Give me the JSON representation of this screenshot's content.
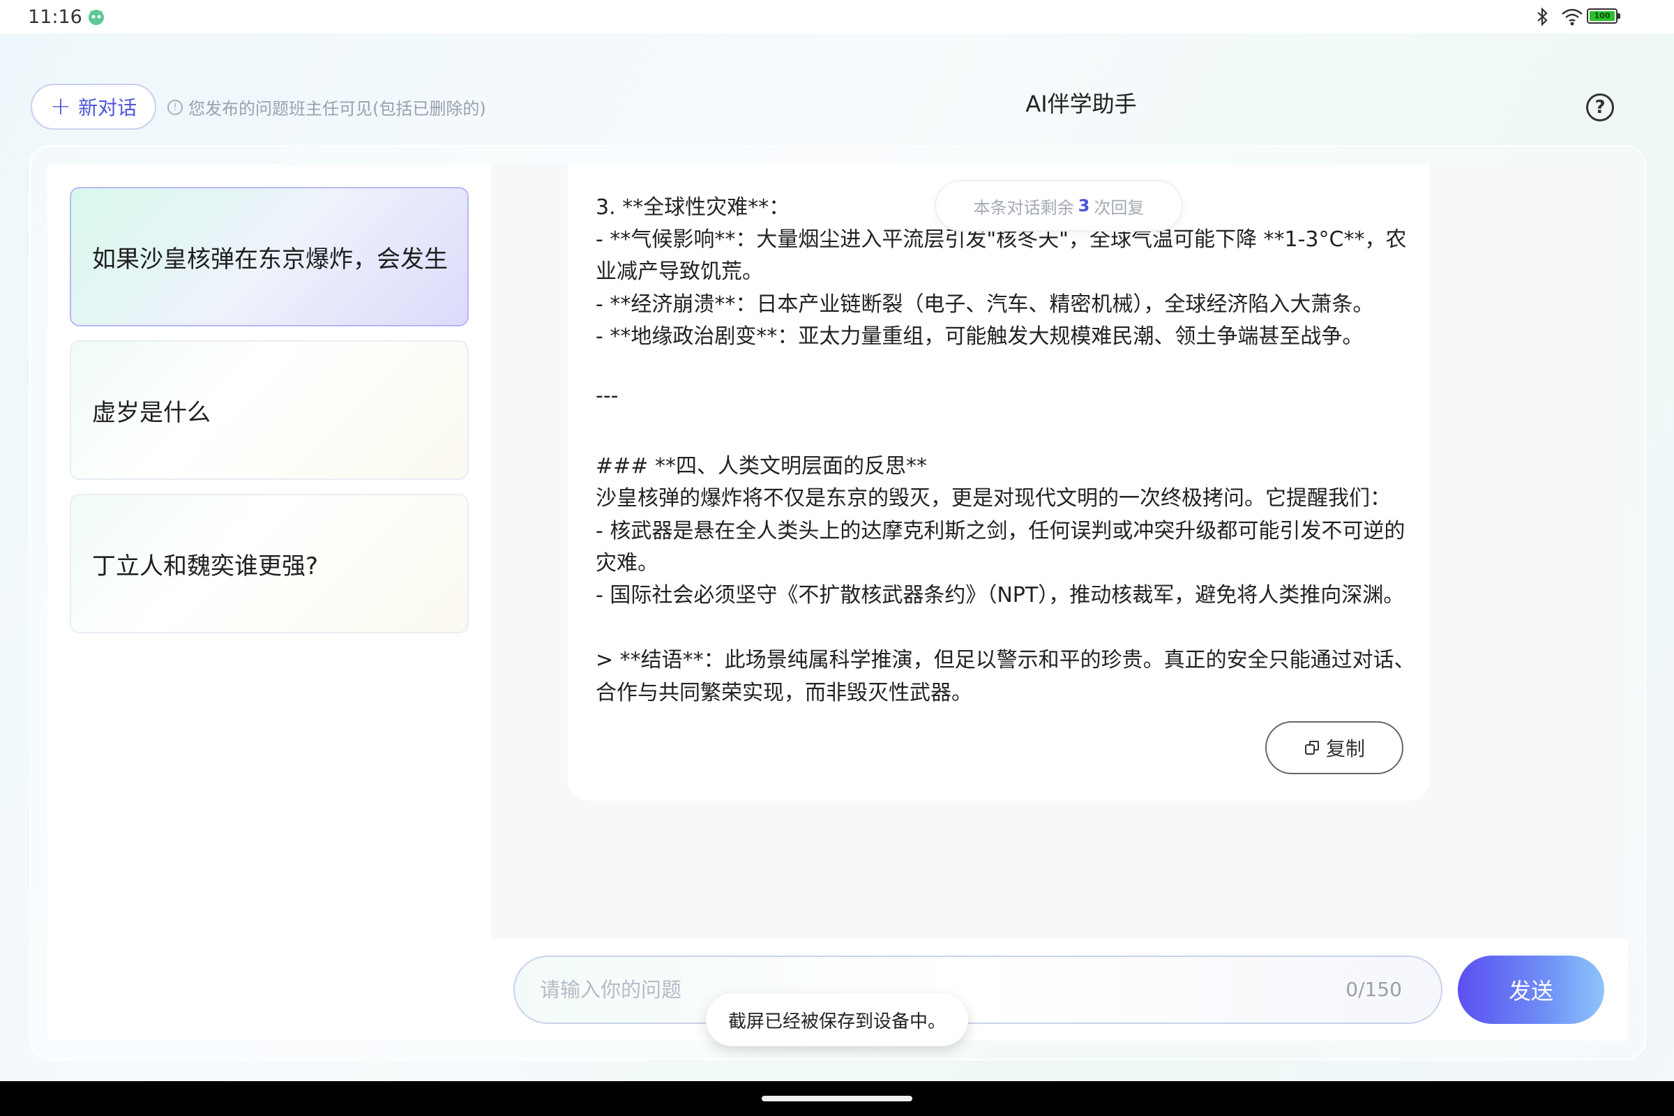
{
  "status_bar": {
    "time": "11:16",
    "battery_label": "100"
  },
  "header": {
    "new_chat_label": "新对话",
    "notice": "您发布的问题班主任可见(包括已删除的)",
    "title": "AI伴学助手"
  },
  "conversations": [
    {
      "title": "如果沙皇核弹在东京爆炸，会发生",
      "active": true
    },
    {
      "title": "虚岁是什么",
      "active": false
    },
    {
      "title": "丁立人和魏奕谁更强?",
      "active": false
    }
  ],
  "remaining": {
    "prefix": "本条对话剩余",
    "count": "3",
    "suffix": "次回复"
  },
  "message": {
    "lines": [
      "3. **全球性灾难**：",
      "  - **气候影响**：大量烟尘进入平流层引发\"核冬天\"，全球气温可能下降 **1-3°C**，农",
      "业减产导致饥荒。",
      "  - **经济崩溃**：日本产业链断裂（电子、汽车、精密机械），全球经济陷入大萧条。",
      "  - **地缘政治剧变**：亚太力量重组，可能触发大规模难民潮、领土争端甚至战争。",
      "",
      "---",
      "",
      "### **四、人类文明层面的反思**",
      "沙皇核弹的爆炸将不仅是东京的毁灭，更是对现代文明的一次终极拷问。它提醒我们：",
      "- 核武器是悬在全人类头上的达摩克利斯之剑，任何误判或冲突升级都可能引发不可逆的",
      "灾难。",
      "- 国际社会必须坚守《不扩散核武器条约》（NPT），推动核裁军，避免将人类推向深渊。",
      "",
      "> **结语**：此场景纯属科学推演，但足以警示和平的珍贵。真正的安全只能通过对话、",
      "合作与共同繁荣实现，而非毁灭性武器。"
    ],
    "copy_label": "复制"
  },
  "input": {
    "placeholder": "请输入你的问题",
    "value": "",
    "char_count": "0/150"
  },
  "send_label": "发送",
  "toast": "截屏已经被保存到设备中。"
}
